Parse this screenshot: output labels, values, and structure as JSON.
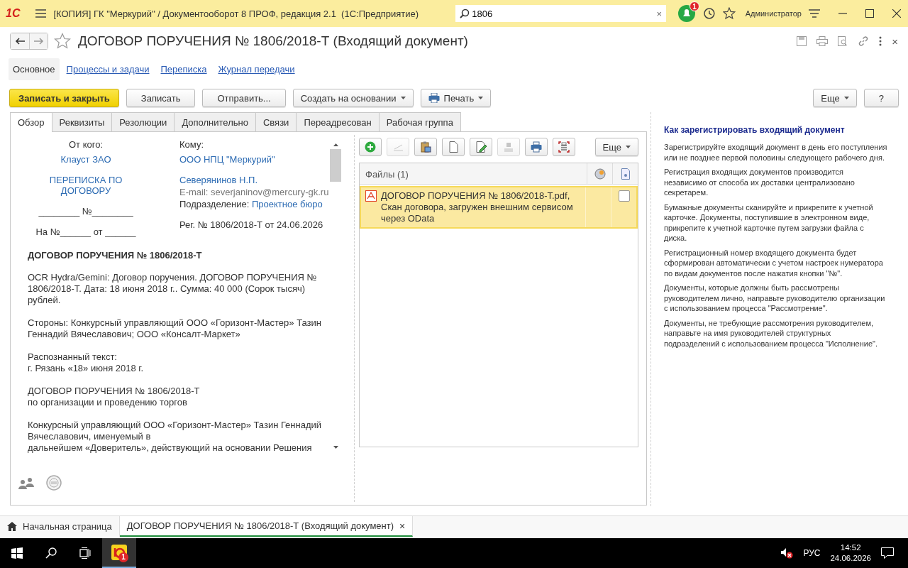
{
  "app_bar": {
    "logo": "1С",
    "title": "[КОПИЯ] ГК \"Меркурий\" / Документооборот 8 ПРОФ, редакция 2.1  (1С:Предприятие)",
    "search": {
      "value": "1806"
    },
    "clear": "×",
    "notifications_badge": "1",
    "user": "Администратор"
  },
  "form": {
    "title": "ДОГОВОР ПОРУЧЕНИЯ № 1806/2018-Т (Входящий документ)",
    "close": "×",
    "nav": [
      {
        "label": "Основное",
        "selected": true
      },
      {
        "label": "Процессы и задачи",
        "selected": false
      },
      {
        "label": "Переписка",
        "selected": false
      },
      {
        "label": "Журнал передачи",
        "selected": false
      }
    ],
    "commands": [
      {
        "label": "Записать и закрыть",
        "kind": "primary"
      },
      {
        "label": "Записать",
        "kind": "plain"
      },
      {
        "label": "Отправить...",
        "kind": "plain"
      },
      {
        "label": "Создать на основании",
        "kind": "menu"
      },
      {
        "label": "Печать",
        "kind": "print"
      }
    ],
    "side_commands": [
      {
        "label": "Еще",
        "kind": "menu"
      },
      {
        "label": "?",
        "kind": "plain"
      }
    ]
  },
  "tabs": [
    {
      "label": "Обзор",
      "selected": true
    },
    {
      "label": "Реквизиты",
      "selected": false
    },
    {
      "label": "Резолюции",
      "selected": false
    },
    {
      "label": "Дополнительно",
      "selected": false
    },
    {
      "label": "Связи",
      "selected": false
    },
    {
      "label": "Переадресован",
      "selected": false
    },
    {
      "label": "Рабочая группа",
      "selected": false
    }
  ],
  "preview": {
    "from_label": "От кого:",
    "from_org": "Клауст ЗАО",
    "subject": "ПЕРЕПИСКА ПО ДОГОВОРУ",
    "number_line": "________ №________",
    "ref_line": "На №______ от ______",
    "to_label": "Кому:",
    "to_org": "ООО НПЦ \"Меркурий\"",
    "to_person": "Северянинов Н.П.",
    "email": "E-mail: severjaninov@mercury-gk.ru",
    "department_label": "Подразделение:",
    "department": "Проектное бюро",
    "reg": "Рег. № 1806/2018-Т от 24.06.2026",
    "heading": "ДОГОВОР ПОРУЧЕНИЯ № 1806/2018-Т",
    "paragraphs": [
      "OCR Hydra/Gemini: Договор поручения. ДОГОВОР ПОРУЧЕНИЯ № 1806/2018-Т. Дата: 18 июня 2018 г.. Сумма: 40 000 (Сорок тысяч) рублей.",
      "Стороны: Конкурсный управляющий ООО «Горизонт-Мастер» Тазин Геннадий Вячеславович; ООО «Консалт-Маркет»",
      "Распознанный текст:\nг. Рязань «18» июня 2018 г.",
      "ДОГОВОР ПОРУЧЕНИЯ № 1806/2018-Т\nпо организации и проведению торгов",
      "Конкурсный управляющий ООО «Горизонт-Мастер» Тазин Геннадий Вячеславович, именуемый в\nдальнейшем «Доверитель», действующий на основании Решения"
    ]
  },
  "files": {
    "tools": [
      {
        "kind": "add",
        "disabled": false
      },
      {
        "kind": "edit",
        "disabled": true
      },
      {
        "kind": "paste",
        "disabled": false
      },
      {
        "kind": "page",
        "disabled": false
      },
      {
        "kind": "sign",
        "disabled": false
      },
      {
        "kind": "stamp",
        "disabled": true
      },
      {
        "kind": "print",
        "disabled": false
      },
      {
        "kind": "scan",
        "disabled": false
      }
    ],
    "more": "Еще",
    "header": "Файлы (1)",
    "rows": [
      {
        "name": "ДОГОВОР ПОРУЧЕНИЯ № 1806/2018-Т.pdf, Скан договора, загружен внешним сервисом через OData",
        "selected": true,
        "checked": false
      }
    ]
  },
  "help": {
    "title": "Как зарегистрировать входящий документ",
    "paragraphs": [
      "Зарегистрируйте входящий документ в день его поступления или не позднее первой половины следующего рабочего дня.",
      "Регистрация входящих документов производится независимо от способа их доставки централизовано секретарем.",
      "Бумажные документы сканируйте и прикрепите к учетной карточке. Документы, поступившие в электронном виде, прикрепите к учетной карточке путем загрузки файла с диска.",
      "Регистрационный номер входящего документа будет сформирован автоматически с учетом настроек нумератора по видам документов после нажатия кнопки \"№\".",
      "Документы, которые должны быть рассмотрены руководителем лично, направьте руководителю организации с использованием процесса \"Рассмотрение\".",
      "Документы, не требующие рассмотрения руководителем, направьте на имя руководителей структурных подразделений с использованием процесса \"Исполнение\"."
    ]
  },
  "open_windows": [
    {
      "label": "Начальная страница",
      "kind": "home",
      "selected": false
    },
    {
      "label": "ДОГОВОР ПОРУЧЕНИЯ № 1806/2018-Т (Входящий документ)",
      "kind": "document",
      "selected": true,
      "close": "×"
    }
  ],
  "taskbar": {
    "app_badge": "1",
    "language": "РУС",
    "time": "14:52",
    "date": "24.06.2026"
  }
}
